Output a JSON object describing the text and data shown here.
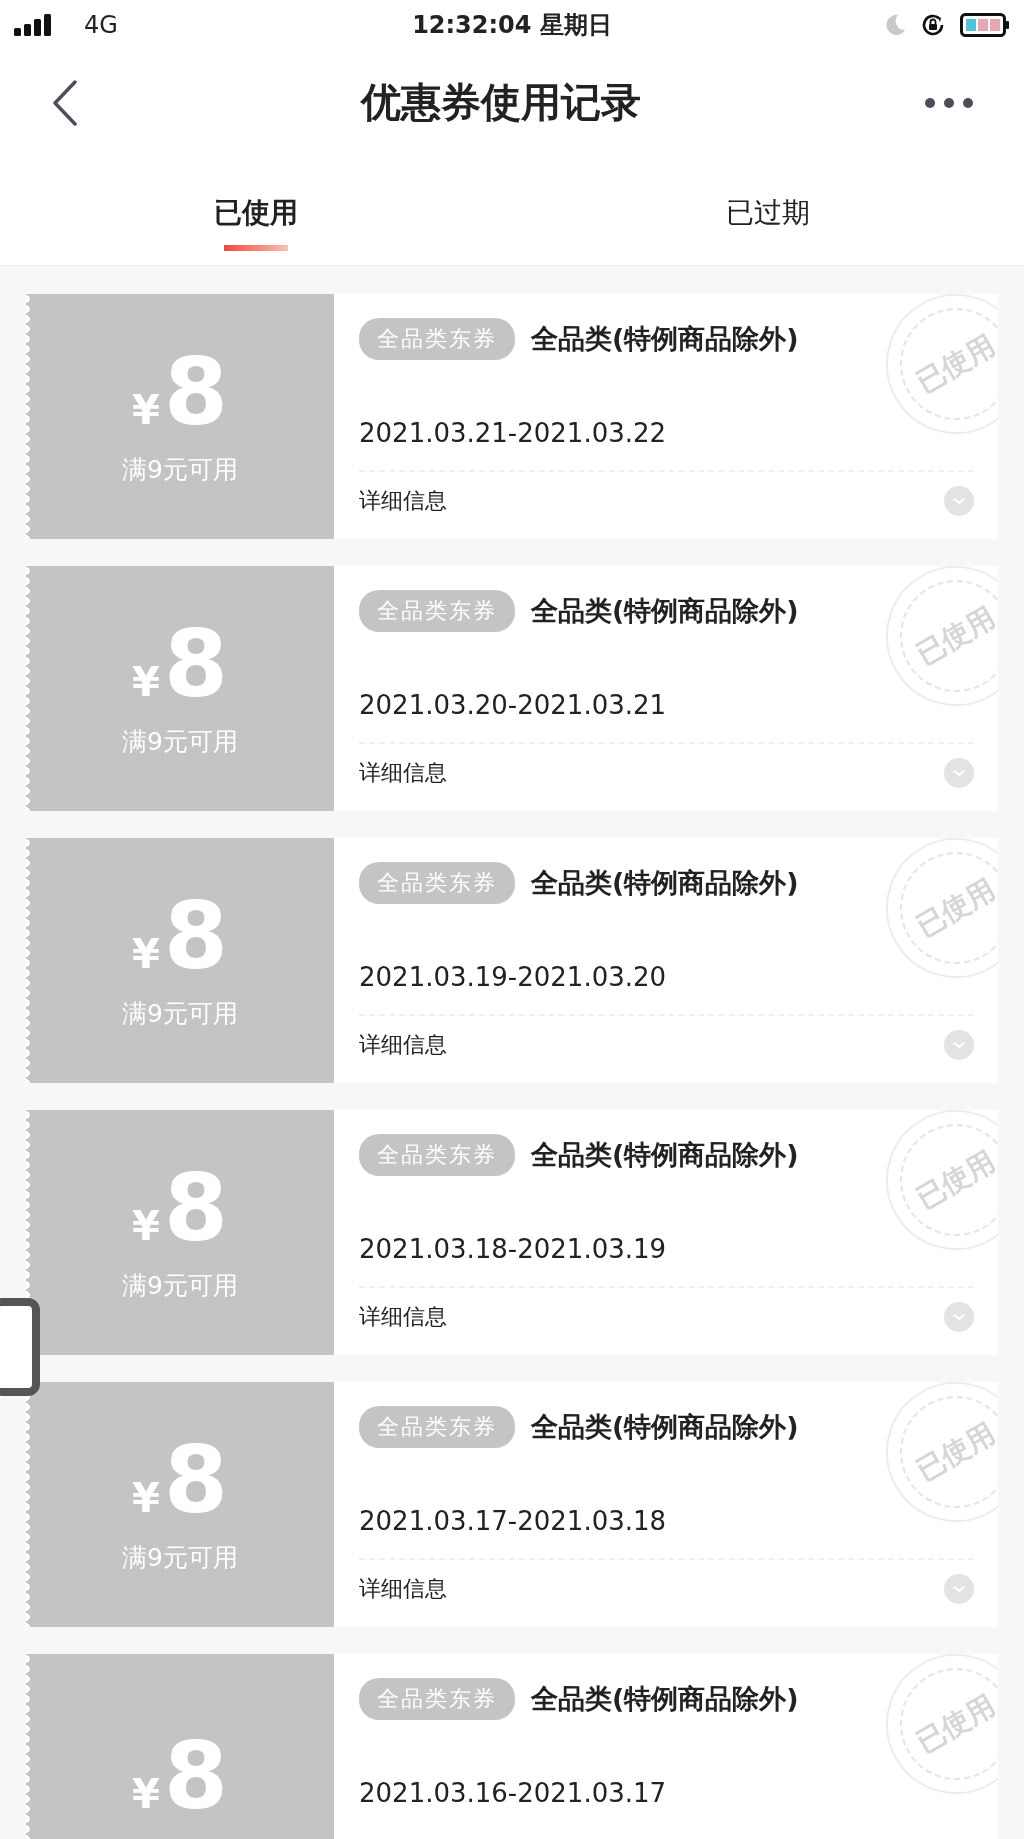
{
  "status_bar": {
    "network": "4G",
    "time": "12:32:04 星期日"
  },
  "nav": {
    "title": "优惠券使用记录"
  },
  "tabs": [
    {
      "label": "已使用",
      "selected": true
    },
    {
      "label": "已过期",
      "selected": false
    }
  ],
  "coupons": [
    {
      "currency": "¥",
      "amount": "8",
      "condition": "满9元可用",
      "tag": "全品类东券",
      "title": "全品类(特例商品除外)",
      "validity": "2021.03.21-2021.03.22",
      "details": "详细信息",
      "stamp": "已使用"
    },
    {
      "currency": "¥",
      "amount": "8",
      "condition": "满9元可用",
      "tag": "全品类东券",
      "title": "全品类(特例商品除外)",
      "validity": "2021.03.20-2021.03.21",
      "details": "详细信息",
      "stamp": "已使用"
    },
    {
      "currency": "¥",
      "amount": "8",
      "condition": "满9元可用",
      "tag": "全品类东券",
      "title": "全品类(特例商品除外)",
      "validity": "2021.03.19-2021.03.20",
      "details": "详细信息",
      "stamp": "已使用"
    },
    {
      "currency": "¥",
      "amount": "8",
      "condition": "满9元可用",
      "tag": "全品类东券",
      "title": "全品类(特例商品除外)",
      "validity": "2021.03.18-2021.03.19",
      "details": "详细信息",
      "stamp": "已使用"
    },
    {
      "currency": "¥",
      "amount": "8",
      "condition": "满9元可用",
      "tag": "全品类东券",
      "title": "全品类(特例商品除外)",
      "validity": "2021.03.17-2021.03.18",
      "details": "详细信息",
      "stamp": "已使用"
    },
    {
      "currency": "¥",
      "amount": "8",
      "tag": "全品类东券",
      "title": "全品类(特例商品除外)",
      "validity": "2021.03.16-2021.03.17",
      "stamp": "已使用"
    }
  ]
}
